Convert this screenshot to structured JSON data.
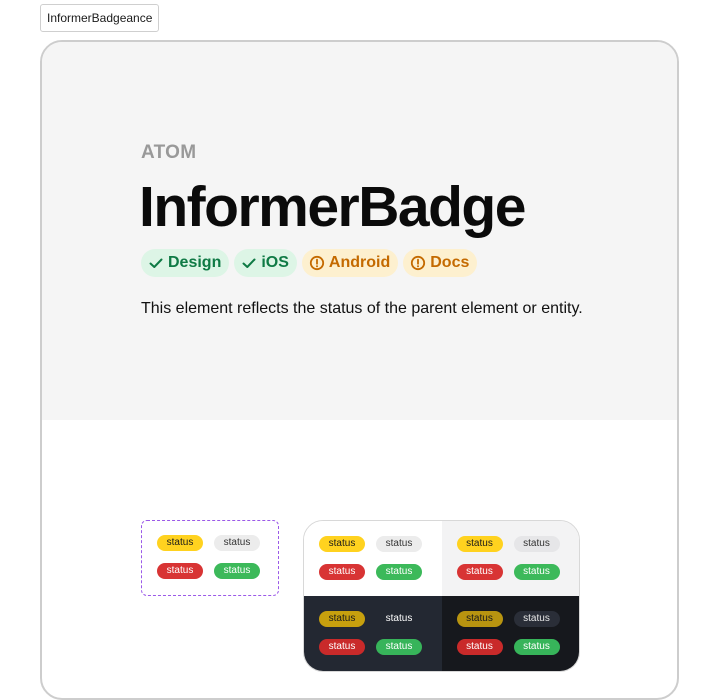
{
  "tab": {
    "label": "InformerBadgeance"
  },
  "hero": {
    "kicker": "ATOM",
    "title": "InformerBadge",
    "chips": [
      {
        "label": "Design",
        "icon": "check-icon",
        "state": "ok"
      },
      {
        "label": "iOS",
        "icon": "check-icon",
        "state": "ok"
      },
      {
        "label": "Android",
        "icon": "warning-circle-icon",
        "state": "warn"
      },
      {
        "label": "Docs",
        "icon": "warning-circle-icon",
        "state": "warn"
      }
    ],
    "description": "This element reflects the status of the parent element or entity."
  },
  "sample": {
    "badges": [
      {
        "label": "status",
        "variant": "warning",
        "color": "#ffd21f"
      },
      {
        "label": "status",
        "variant": "neutral",
        "color": "#ececec"
      },
      {
        "label": "status",
        "variant": "error",
        "color": "#d83434"
      },
      {
        "label": "status",
        "variant": "success",
        "color": "#3cb95a"
      }
    ]
  },
  "themes": {
    "light": [
      "status",
      "status",
      "status",
      "status"
    ],
    "light_gray": [
      "status",
      "status",
      "status",
      "status"
    ],
    "dark": [
      "status",
      "status",
      "status",
      "status"
    ],
    "dark_black": [
      "status",
      "status",
      "status",
      "status"
    ]
  },
  "colors": {
    "chip_ok_bg": "#ddf5e6",
    "chip_ok_text": "#0f7a45",
    "chip_warn_bg": "#fdf0cf",
    "chip_warn_text": "#c46a00",
    "selection_border": "#9b59e8"
  }
}
